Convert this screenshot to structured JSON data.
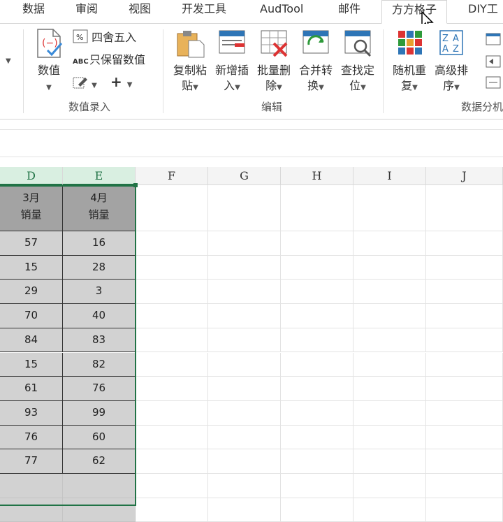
{
  "tabs": [
    {
      "label": "数据"
    },
    {
      "label": "审阅"
    },
    {
      "label": "视图"
    },
    {
      "label": "开发工具"
    },
    {
      "label": "AudTool"
    },
    {
      "label": "邮件"
    },
    {
      "label": "方方格子"
    },
    {
      "label": "DIY工"
    }
  ],
  "ribbon": {
    "number_group": {
      "value_btn": "数值",
      "round_btn": "四舍五入",
      "keep_value_btn": "只保留数值",
      "plus_label": "+",
      "label": "数值录入"
    },
    "edit_group": {
      "copy_paste_l1": "复制粘",
      "copy_paste_l2": "贴",
      "insert_l1": "新增插",
      "insert_l2": "入",
      "batch_delete_l1": "批量删",
      "batch_delete_l2": "除",
      "merge_l1": "合并转",
      "merge_l2": "换",
      "find_l1": "查找定",
      "find_l2": "位",
      "label": "编辑"
    },
    "analysis_group": {
      "random_l1": "随机重",
      "random_l2": "复",
      "sort_l1": "高级排",
      "sort_l2": "序",
      "label": "数据分机"
    }
  },
  "columns": [
    "D",
    "E",
    "F",
    "G",
    "H",
    "I",
    "J"
  ],
  "table": {
    "headers": [
      [
        "3月",
        "销量"
      ],
      [
        "4月",
        "销量"
      ]
    ],
    "rows": [
      [
        "57",
        "16"
      ],
      [
        "15",
        "28"
      ],
      [
        "29",
        "3"
      ],
      [
        "70",
        "40"
      ],
      [
        "84",
        "83"
      ],
      [
        "15",
        "82"
      ],
      [
        "61",
        "76"
      ],
      [
        "93",
        "99"
      ],
      [
        "76",
        "60"
      ],
      [
        "77",
        "62"
      ]
    ]
  },
  "colors": {
    "accent": "#217346",
    "header_fill": "#a3a3a3",
    "data_fill": "#d2d2d2"
  }
}
